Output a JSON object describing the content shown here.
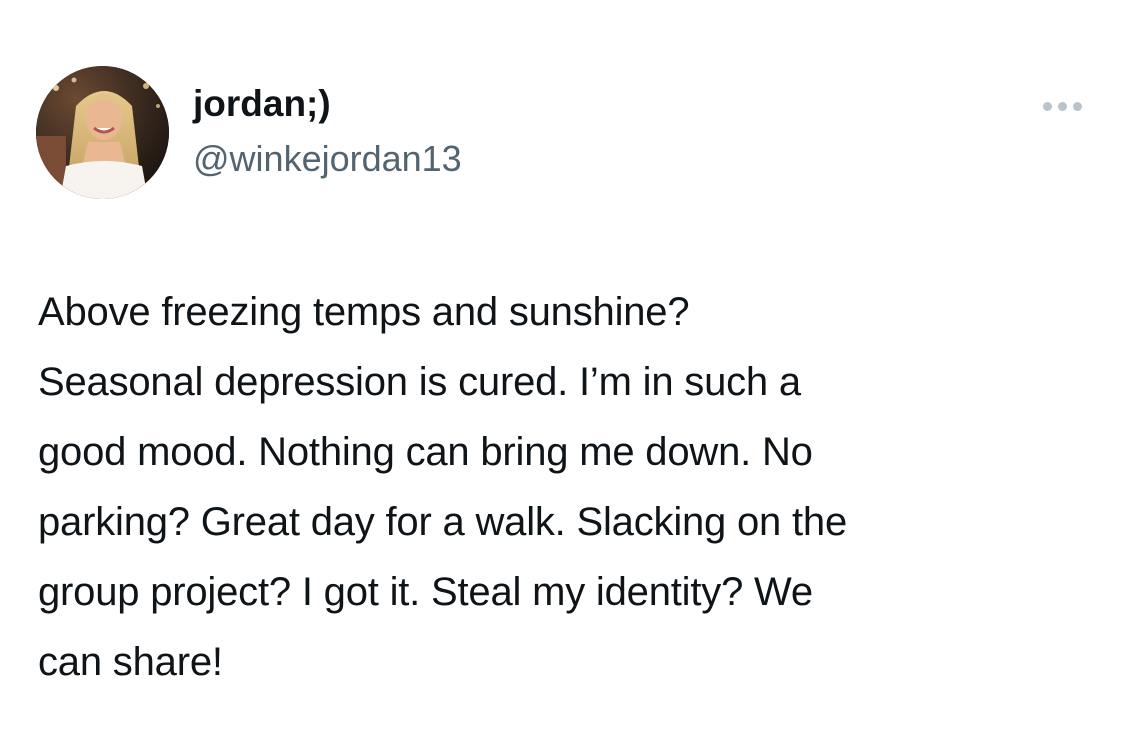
{
  "tweet": {
    "author": {
      "display_name": "jordan;)",
      "handle": "@winkejordan13",
      "avatar_icon": "profile-photo"
    },
    "more_icon": "more-options-ellipsis-icon",
    "text_lines": [
      "Above freezing temps and sunshine?",
      "Seasonal depression is cured. I’m in such a",
      "good mood. Nothing can bring me down. No",
      "parking? Great day for a walk. Slacking on the",
      "group project? I got it. Steal my identity? We",
      "can share!"
    ],
    "colors": {
      "text": "#0f1419",
      "secondary": "#536471",
      "icon": "#b9c3cc"
    }
  }
}
